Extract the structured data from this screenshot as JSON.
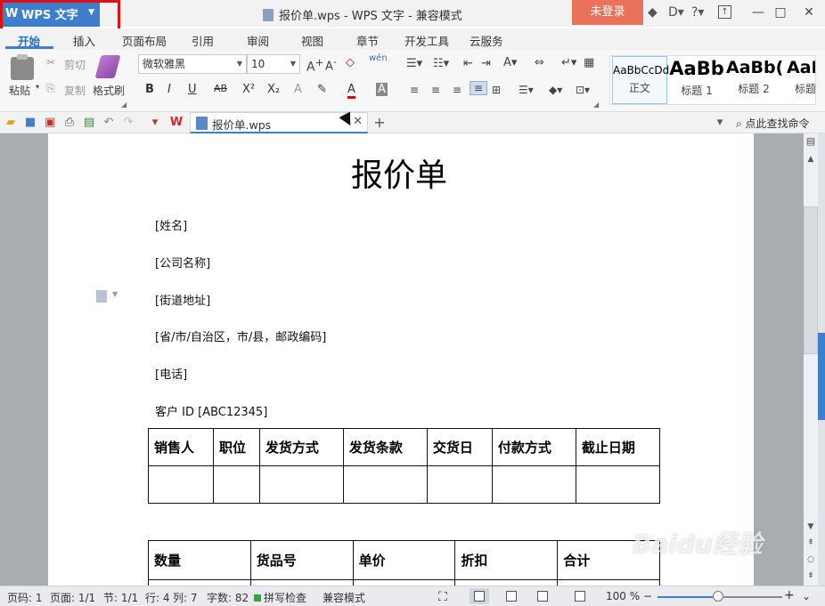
{
  "app": {
    "menu_button": "WPS 文字",
    "title": "报价单.wps - WPS 文字 - 兼容模式",
    "login": "未登录"
  },
  "tabs": [
    "开始",
    "插入",
    "页面布局",
    "引用",
    "审阅",
    "视图",
    "章节",
    "开发工具",
    "云服务"
  ],
  "ribbon": {
    "paste": "粘贴",
    "cut": "剪切",
    "copy": "复制",
    "format_painter": "格式刷",
    "font_name": "微软雅黑",
    "font_size": "10",
    "styles": [
      {
        "preview": "AaBbCcDd",
        "name": "正文"
      },
      {
        "preview": "AaBb",
        "name": "标题 1"
      },
      {
        "preview": "AaBb(",
        "name": "标题 2"
      },
      {
        "preview": "AaB",
        "name": "标题"
      }
    ]
  },
  "quickbar": {
    "doc_tab": "报价单.wps",
    "search_command": "点此查找命令"
  },
  "document": {
    "title": "报价单",
    "fields": [
      "[姓名]",
      "[公司名称]",
      "[街道地址]",
      "[省/市/自治区，市/县，邮政编码]",
      "[电话]",
      "客户  ID [ABC12345]"
    ],
    "table1_headers": [
      "销售人",
      "职位",
      "发货方式",
      "发货条款",
      "交货日",
      "付款方式",
      "截止日期"
    ],
    "table2_headers": [
      "数量",
      "货品号",
      "单价",
      "折扣",
      "合计"
    ]
  },
  "status": {
    "page": "页码: 1",
    "pages": "页面: 1/1",
    "section": "节: 1/1",
    "row": "行: 4",
    "col": "列: 7",
    "words": "字数: 82",
    "spell": "拼写检查",
    "compat": "兼容模式",
    "zoom": "100 %"
  },
  "watermark": "Baidu经验",
  "colors": {
    "accent": "#3d7fcd",
    "login": "#e8735a",
    "highlight": "#e01010"
  }
}
